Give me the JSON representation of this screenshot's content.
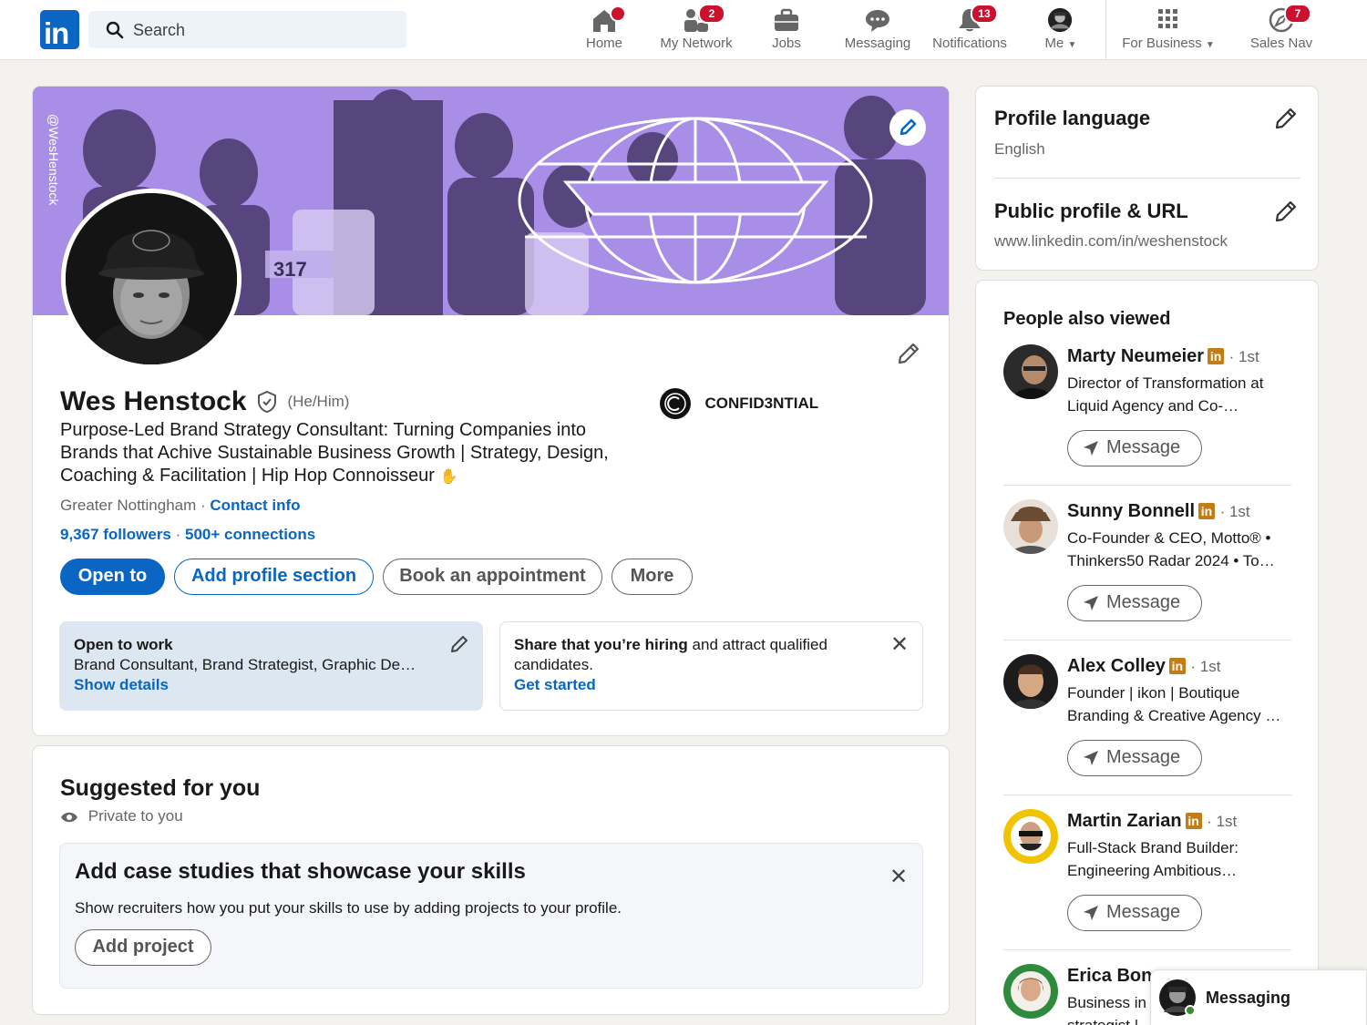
{
  "nav": {
    "logo_text": "in",
    "search_placeholder": "Search",
    "items": [
      {
        "label": "Home",
        "badge": ""
      },
      {
        "label": "My Network",
        "badge": "2"
      },
      {
        "label": "Jobs",
        "badge": ""
      },
      {
        "label": "Messaging",
        "badge": ""
      },
      {
        "label": "Notifications",
        "badge": "13"
      },
      {
        "label": "Me",
        "badge": ""
      },
      {
        "label": "For Business",
        "badge": ""
      },
      {
        "label": "Sales Nav",
        "badge": "7"
      }
    ]
  },
  "profile": {
    "banner_handle": "@WesHenstock",
    "name": "Wes Henstock",
    "pronouns": "(He/Him)",
    "headline_lines": [
      "Purpose-Led Brand Strategy Consultant: Turning Companies into",
      "Brands that Achive Sustainable Business Growth | Strategy, Design,",
      "Coaching & Facilitation | Hip Hop Connoisseur"
    ],
    "location": "Greater Nottingham",
    "contact_info": "Contact info",
    "followers": "9,367 followers",
    "connections": "500+ connections",
    "company": "CONFID3NTIAL",
    "buttons": {
      "open_to": "Open to",
      "add_section": "Add profile section",
      "book": "Book an appointment",
      "more": "More"
    },
    "open_to_work": {
      "title": "Open to work",
      "roles": "Brand Consultant, Brand Strategist, Graphic De…",
      "show_details": "Show details"
    },
    "hiring": {
      "bold": "Share that you’re hiring",
      "rest": " and attract qualified",
      "line2": "candidates.",
      "cta": "Get started"
    }
  },
  "suggested": {
    "title": "Suggested for you",
    "private": "Private to you",
    "card_title": "Add case studies that showcase your skills",
    "card_body": "Show recruiters how you put your skills to use by adding projects to your profile.",
    "card_button": "Add project"
  },
  "sidebar": {
    "language_title": "Profile language",
    "language_value": "English",
    "url_title": "Public profile & URL",
    "url_value": "www.linkedin.com/in/weshenstock",
    "people_title": "People also viewed",
    "people": [
      {
        "name": "Marty Neumeier",
        "degree": "· 1st",
        "line1": "Director of Transformation at",
        "line2": "Liquid Agency and Co-…",
        "button": "Message"
      },
      {
        "name": "Sunny Bonnell",
        "degree": "· 1st",
        "line1": "Co-Founder & CEO, Motto® •",
        "line2": "Thinkers50 Radar 2024 • To…",
        "button": "Message"
      },
      {
        "name": "Alex Colley",
        "degree": "· 1st",
        "line1": "Founder | ikon | Boutique",
        "line2": "Branding & Creative Agency …",
        "button": "Message"
      },
      {
        "name": "Martin Zarian",
        "degree": "· 1st",
        "line1": "Full-Stack Brand Builder:",
        "line2": "Engineering Ambitious…",
        "button": "Message"
      },
      {
        "name": "Erica Bon",
        "degree": "",
        "line1": "Business in",
        "line2": "strategist |",
        "button": ""
      }
    ],
    "messaging_label": "Messaging"
  },
  "colors": {
    "accent": "#0a66c2",
    "banner": "#a98ee6",
    "badge": "#cb112d",
    "page_bg": "#f4f2ee"
  }
}
